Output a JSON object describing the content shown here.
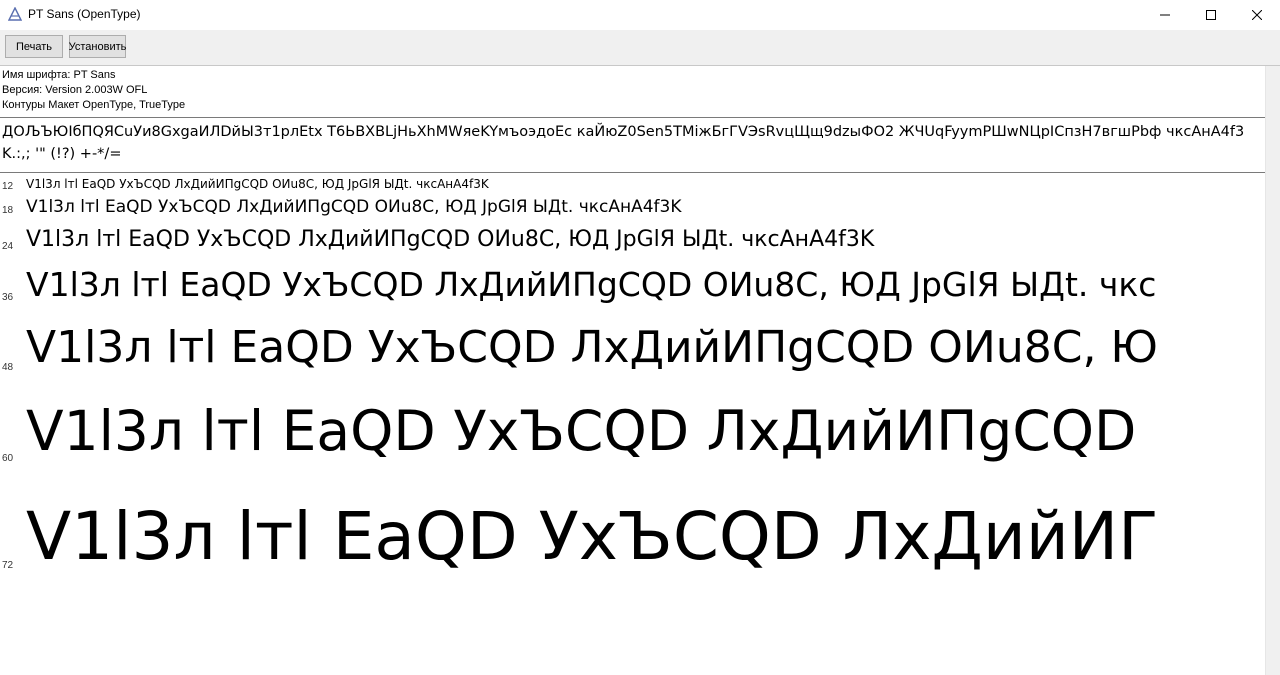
{
  "window": {
    "title": "PT Sans (OpenType)",
    "controls": [
      "minimize",
      "maximize",
      "close"
    ]
  },
  "toolbar": {
    "print_label": "Печать",
    "install_label": "Установить"
  },
  "font_info": {
    "name_line": "Имя шрифта: PT Sans",
    "version_line": "Версия: Version 2.003W OFL",
    "outline_line": "Контуры Макет OpenType, TrueType"
  },
  "charset_text": "ДОЉЪЮІбПQЯСuУи8GxgaИЛDйЫ3т1рлEtx T6ЬBXBLjНьXhMWяeKYмъоэдоEc каЙюZ0Sen5TMiжБгГVЭsRvцЩщ9dzыФО2 ЖЧUqFyymPШwNЦрIСпзН7вгшPbф чксАнА4f3K.:,; '\" (!?) +-*/=",
  "samples": [
    {
      "size": "12",
      "text": "V1l3л lтl EaQD УхЪCQD ЛхДийИПgCQD OИu8C, ЮД JpGlЯ ЫДt. чксАнА4f3K"
    },
    {
      "size": "18",
      "text": "V1l3л lтl EaQD УхЪCQD ЛхДийИПgCQD OИu8C, ЮД JpGlЯ ЫДt. чксАнА4f3K"
    },
    {
      "size": "24",
      "text": "V1l3л lтl EaQD УхЪCQD ЛхДийИПgCQD OИu8C, ЮД JpGlЯ ЫДt. чксАнА4f3K"
    },
    {
      "size": "36",
      "text": "V1l3л lтl EaQD УхЪCQD ЛхДийИПgCQD OИu8C, ЮД JpGlЯ ЫДt. чкс"
    },
    {
      "size": "48",
      "text": "V1l3л lтl EaQD УхЪCQD ЛхДийИПgCQD OИu8C, Ю"
    },
    {
      "size": "60",
      "text": "V1l3л lтl EaQD УхЪCQD ЛхДийИПgCQD"
    },
    {
      "size": "72",
      "text": "V1l3л lтl EaQD УхЪCQD ЛхДийИГ"
    }
  ]
}
